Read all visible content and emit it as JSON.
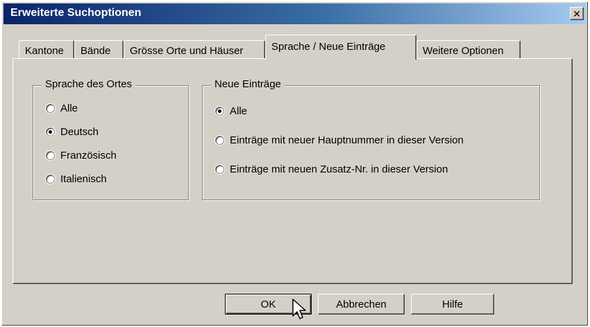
{
  "window": {
    "title": "Erweiterte Suchoptionen",
    "close_glyph": "✕"
  },
  "tabs": [
    {
      "label": "Kantone",
      "active": false
    },
    {
      "label": "Bände",
      "active": false
    },
    {
      "label": "Grösse Orte und Häuser",
      "active": false
    },
    {
      "label": "Sprache / Neue Einträge",
      "active": true
    },
    {
      "label": "Weitere Optionen",
      "active": false
    }
  ],
  "language_group": {
    "legend": "Sprache des Ortes",
    "options": [
      {
        "label": "Alle",
        "checked": false
      },
      {
        "label": "Deutsch",
        "checked": true
      },
      {
        "label": "Französisch",
        "checked": false
      },
      {
        "label": "Italienisch",
        "checked": false
      }
    ]
  },
  "new_entries_group": {
    "legend": "Neue Einträge",
    "options": [
      {
        "label": "Alle",
        "checked": true
      },
      {
        "label": "Einträge mit neuer Hauptnummer in dieser Version",
        "checked": false
      },
      {
        "label": "Einträge mit neuen Zusatz-Nr. in dieser Version",
        "checked": false
      }
    ]
  },
  "buttons": {
    "ok": "OK",
    "cancel": "Abbrechen",
    "help": "Hilfe"
  },
  "icons": {
    "close": "close-icon",
    "cursor": "mouse-pointer-icon"
  }
}
